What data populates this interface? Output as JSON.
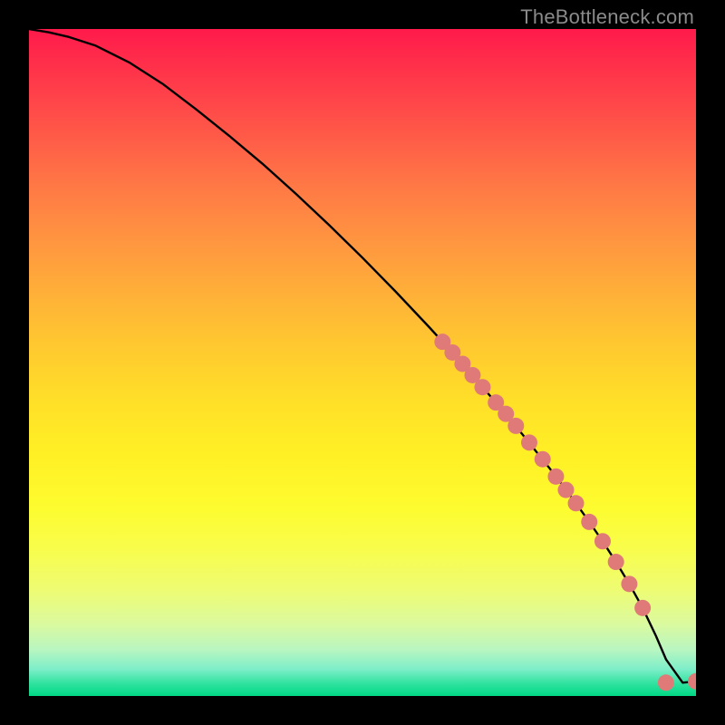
{
  "attribution": "TheBottleneck.com",
  "chart_data": {
    "type": "line",
    "title": "",
    "xlabel": "",
    "ylabel": "",
    "xlim": [
      0,
      100
    ],
    "ylim": [
      0,
      100
    ],
    "grid": false,
    "curve": {
      "x": [
        0,
        3,
        6,
        10,
        15,
        20,
        25,
        30,
        35,
        40,
        45,
        50,
        55,
        60,
        62,
        64,
        66,
        68,
        70,
        72,
        74,
        76,
        78,
        80,
        82,
        84,
        86,
        88,
        90,
        92,
        94,
        95.5,
        98,
        100
      ],
      "y": [
        100,
        99.5,
        98.8,
        97.5,
        95.0,
        91.8,
        88.0,
        84.0,
        79.8,
        75.3,
        70.6,
        65.7,
        60.6,
        55.3,
        53.1,
        50.9,
        48.6,
        46.3,
        44.0,
        41.6,
        39.2,
        36.7,
        34.2,
        31.6,
        28.9,
        26.1,
        23.2,
        20.1,
        16.8,
        13.2,
        9.0,
        5.5,
        2.0,
        2.2
      ]
    },
    "points": {
      "x": [
        62,
        63.5,
        65,
        66.5,
        68,
        70,
        71.5,
        73,
        75,
        77,
        79,
        80.5,
        82,
        84,
        86,
        88,
        90,
        92,
        95.5,
        100
      ],
      "y": [
        53.1,
        51.5,
        49.8,
        48.1,
        46.3,
        44.0,
        42.3,
        40.5,
        38.0,
        35.5,
        32.9,
        30.9,
        28.9,
        26.1,
        23.2,
        20.1,
        16.8,
        13.2,
        2.0,
        2.2
      ]
    },
    "marker_color": "#e07a78",
    "background": "heatmap-gradient"
  }
}
